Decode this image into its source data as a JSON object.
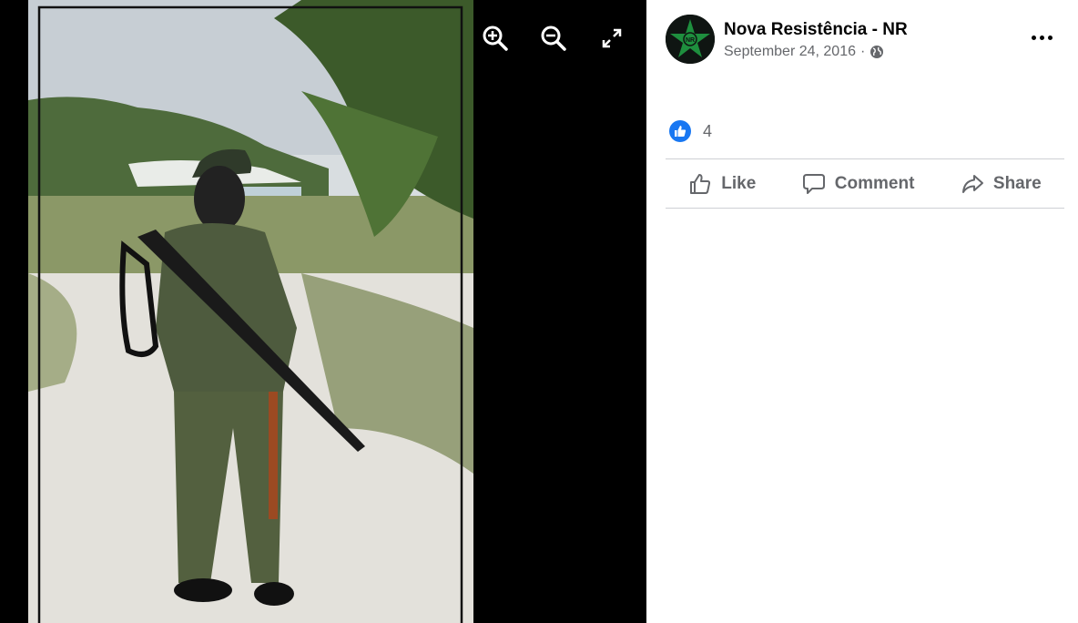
{
  "viewer": {
    "tools": [
      {
        "name": "zoom-in-icon"
      },
      {
        "name": "zoom-out-icon"
      },
      {
        "name": "fullscreen-icon"
      }
    ]
  },
  "post": {
    "page_name": "Nova Resistência - NR",
    "date": "September 24, 2016",
    "separator": "·",
    "privacy_icon": "globe-icon",
    "avatar_text": "NR",
    "more_icon": "more-options-icon"
  },
  "reactions": {
    "icon": "like-reaction-icon",
    "count": "4"
  },
  "actions": {
    "like_label": "Like",
    "comment_label": "Comment",
    "share_label": "Share"
  },
  "colors": {
    "like_blue": "#1877f2",
    "secondary_text": "#65676b",
    "avatar_star": "#1e8f3e"
  }
}
